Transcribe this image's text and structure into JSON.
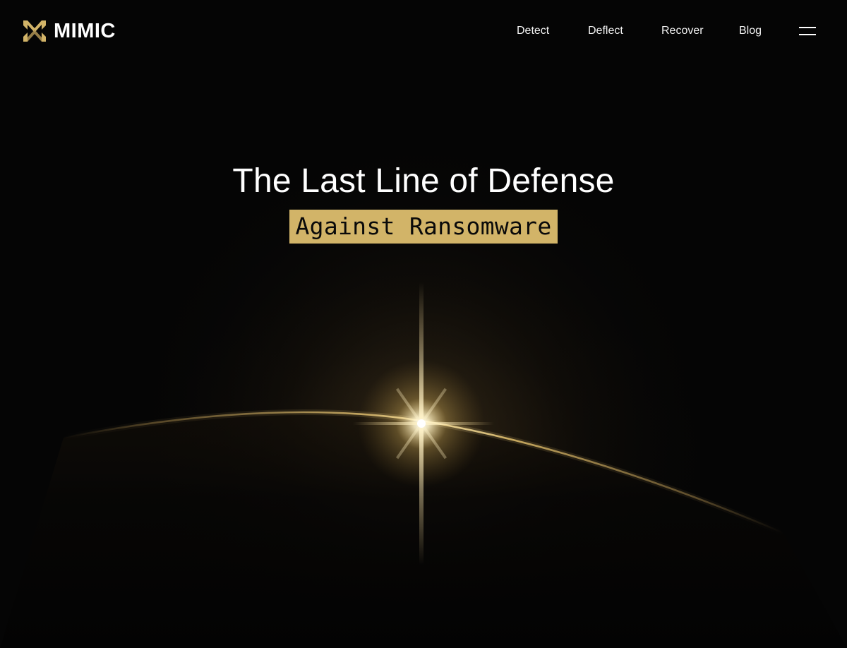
{
  "header": {
    "brand": "MIMIC",
    "nav": [
      {
        "label": "Detect"
      },
      {
        "label": "Deflect"
      },
      {
        "label": "Recover"
      },
      {
        "label": "Blog"
      }
    ],
    "menu_icon": "hamburger-menu-icon"
  },
  "hero": {
    "title": "The Last Line of Defense",
    "subtitle": "Against Ransomware"
  },
  "colors": {
    "background": "#050505",
    "accent_gold": "#d2b468",
    "text": "#ffffff"
  }
}
